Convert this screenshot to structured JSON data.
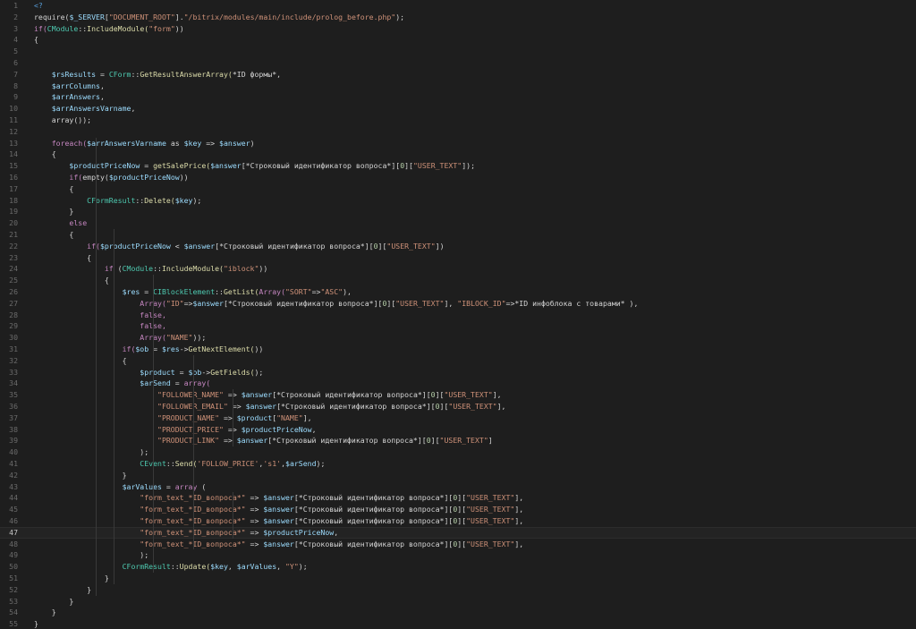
{
  "editor": {
    "lines": [
      [
        {
          "t": "<?",
          "c": "tag"
        }
      ],
      [
        {
          "t": "require(",
          "c": "op"
        },
        {
          "t": "$_SERVER",
          "c": "var"
        },
        {
          "t": "[",
          "c": "op"
        },
        {
          "t": "\"DOCUMENT_ROOT\"",
          "c": "str"
        },
        {
          "t": "].",
          "c": "op"
        },
        {
          "t": "\"/bitrix/modules/main/include/prolog_before.php\"",
          "c": "str"
        },
        {
          "t": ");",
          "c": "op"
        }
      ],
      [
        {
          "t": "if(",
          "c": "kw"
        },
        {
          "t": "CModule",
          "c": "cls"
        },
        {
          "t": "::",
          "c": "op"
        },
        {
          "t": "IncludeModule(",
          "c": "fn"
        },
        {
          "t": "\"form\"",
          "c": "str"
        },
        {
          "t": "))",
          "c": "op"
        }
      ],
      [
        {
          "t": "{",
          "c": "op"
        }
      ],
      [],
      [],
      [
        {
          "t": "    $rsResults",
          "c": "var"
        },
        {
          "t": " = ",
          "c": "op"
        },
        {
          "t": "CForm",
          "c": "cls"
        },
        {
          "t": "::",
          "c": "op"
        },
        {
          "t": "GetResultAnswerArray(",
          "c": "fn"
        },
        {
          "t": "*ID формы*,",
          "c": "op"
        }
      ],
      [
        {
          "t": "    $arrColumns",
          "c": "var"
        },
        {
          "t": ",",
          "c": "op"
        }
      ],
      [
        {
          "t": "    $arrAnswers",
          "c": "var"
        },
        {
          "t": ",",
          "c": "op"
        }
      ],
      [
        {
          "t": "    $arrAnswersVarname",
          "c": "var"
        },
        {
          "t": ",",
          "c": "op"
        }
      ],
      [
        {
          "t": "    array());",
          "c": "op"
        }
      ],
      [],
      [
        {
          "t": "    foreach(",
          "c": "kw"
        },
        {
          "t": "$arrAnswersVarname",
          "c": "var"
        },
        {
          "t": " as ",
          "c": "op"
        },
        {
          "t": "$key",
          "c": "var"
        },
        {
          "t": " => ",
          "c": "op"
        },
        {
          "t": "$answer",
          "c": "var"
        },
        {
          "t": ")",
          "c": "op"
        }
      ],
      [
        {
          "t": "    {",
          "c": "op"
        }
      ],
      [
        {
          "t": "        $productPriceNow",
          "c": "var"
        },
        {
          "t": " = ",
          "c": "op"
        },
        {
          "t": "getSalePrice(",
          "c": "fn"
        },
        {
          "t": "$answer",
          "c": "var"
        },
        {
          "t": "[*Строковый идентификатор вопроса*][",
          "c": "op"
        },
        {
          "t": "0",
          "c": "num"
        },
        {
          "t": "][",
          "c": "op"
        },
        {
          "t": "\"USER_TEXT\"",
          "c": "str"
        },
        {
          "t": "]);",
          "c": "op"
        }
      ],
      [
        {
          "t": "        if(",
          "c": "kw"
        },
        {
          "t": "empty(",
          "c": "op"
        },
        {
          "t": "$productPriceNow",
          "c": "var"
        },
        {
          "t": "))",
          "c": "op"
        }
      ],
      [
        {
          "t": "        {",
          "c": "op"
        }
      ],
      [
        {
          "t": "            CFormResult",
          "c": "cls"
        },
        {
          "t": "::",
          "c": "op"
        },
        {
          "t": "Delete(",
          "c": "fn"
        },
        {
          "t": "$key",
          "c": "var"
        },
        {
          "t": ");",
          "c": "op"
        }
      ],
      [
        {
          "t": "        }",
          "c": "op"
        }
      ],
      [
        {
          "t": "        else",
          "c": "kw"
        }
      ],
      [
        {
          "t": "        {",
          "c": "op"
        }
      ],
      [
        {
          "t": "            if(",
          "c": "kw"
        },
        {
          "t": "$productPriceNow",
          "c": "var"
        },
        {
          "t": " < ",
          "c": "op"
        },
        {
          "t": "$answer",
          "c": "var"
        },
        {
          "t": "[*Строковый идентификатор вопроса*][",
          "c": "op"
        },
        {
          "t": "0",
          "c": "num"
        },
        {
          "t": "][",
          "c": "op"
        },
        {
          "t": "\"USER_TEXT\"",
          "c": "str"
        },
        {
          "t": "])",
          "c": "op"
        }
      ],
      [
        {
          "t": "            {",
          "c": "op"
        }
      ],
      [
        {
          "t": "                if",
          "c": "kw"
        },
        {
          "t": " (",
          "c": "op"
        },
        {
          "t": "CModule",
          "c": "cls"
        },
        {
          "t": "::",
          "c": "op"
        },
        {
          "t": "IncludeModule(",
          "c": "fn"
        },
        {
          "t": "\"iblock\"",
          "c": "str"
        },
        {
          "t": "))",
          "c": "op"
        }
      ],
      [
        {
          "t": "                {",
          "c": "op"
        }
      ],
      [
        {
          "t": "                    $res",
          "c": "var"
        },
        {
          "t": " = ",
          "c": "op"
        },
        {
          "t": "CIBlockElement",
          "c": "cls"
        },
        {
          "t": "::",
          "c": "op"
        },
        {
          "t": "GetList(",
          "c": "fn"
        },
        {
          "t": "Array(",
          "c": "kw"
        },
        {
          "t": "\"SORT\"",
          "c": "str"
        },
        {
          "t": "=>",
          "c": "op"
        },
        {
          "t": "\"ASC\"",
          "c": "str"
        },
        {
          "t": "),",
          "c": "op"
        }
      ],
      [
        {
          "t": "                        Array(",
          "c": "kw"
        },
        {
          "t": "\"ID\"",
          "c": "str"
        },
        {
          "t": "=>",
          "c": "op"
        },
        {
          "t": "$answer",
          "c": "var"
        },
        {
          "t": "[*Строковый идентификатор вопроса*][",
          "c": "op"
        },
        {
          "t": "0",
          "c": "num"
        },
        {
          "t": "][",
          "c": "op"
        },
        {
          "t": "\"USER_TEXT\"",
          "c": "str"
        },
        {
          "t": "], ",
          "c": "op"
        },
        {
          "t": "\"IBLOCK_ID\"",
          "c": "str"
        },
        {
          "t": "=>*ID инфоблока с товарами* ),",
          "c": "op"
        }
      ],
      [
        {
          "t": "                        false,",
          "c": "kw"
        }
      ],
      [
        {
          "t": "                        false,",
          "c": "kw"
        }
      ],
      [
        {
          "t": "                        Array(",
          "c": "kw"
        },
        {
          "t": "\"NAME\"",
          "c": "str"
        },
        {
          "t": "));",
          "c": "op"
        }
      ],
      [
        {
          "t": "                    if(",
          "c": "kw"
        },
        {
          "t": "$ob",
          "c": "var"
        },
        {
          "t": " = ",
          "c": "op"
        },
        {
          "t": "$res",
          "c": "var"
        },
        {
          "t": "->",
          "c": "op"
        },
        {
          "t": "GetNextElement(",
          "c": "fn"
        },
        {
          "t": "))",
          "c": "op"
        }
      ],
      [
        {
          "t": "                    {",
          "c": "op"
        }
      ],
      [
        {
          "t": "                        $product",
          "c": "var"
        },
        {
          "t": " = ",
          "c": "op"
        },
        {
          "t": "$ob",
          "c": "var"
        },
        {
          "t": "->",
          "c": "op"
        },
        {
          "t": "GetFields(",
          "c": "fn"
        },
        {
          "t": ");",
          "c": "op"
        }
      ],
      [
        {
          "t": "                        $arSend",
          "c": "var"
        },
        {
          "t": " = ",
          "c": "op"
        },
        {
          "t": "array(",
          "c": "kw"
        }
      ],
      [
        {
          "t": "                            \"FOLLOWER_NAME\"",
          "c": "str"
        },
        {
          "t": " => ",
          "c": "op"
        },
        {
          "t": "$answer",
          "c": "var"
        },
        {
          "t": "[*Строковый идентификатор вопроса*][",
          "c": "op"
        },
        {
          "t": "0",
          "c": "num"
        },
        {
          "t": "][",
          "c": "op"
        },
        {
          "t": "\"USER_TEXT\"",
          "c": "str"
        },
        {
          "t": "],",
          "c": "op"
        }
      ],
      [
        {
          "t": "                            \"FOLLOWER_EMAIL\"",
          "c": "str"
        },
        {
          "t": " => ",
          "c": "op"
        },
        {
          "t": "$answer",
          "c": "var"
        },
        {
          "t": "[*Строковый идентификатор вопроса*][",
          "c": "op"
        },
        {
          "t": "0",
          "c": "num"
        },
        {
          "t": "][",
          "c": "op"
        },
        {
          "t": "\"USER_TEXT\"",
          "c": "str"
        },
        {
          "t": "],",
          "c": "op"
        }
      ],
      [
        {
          "t": "                            \"PRODUCT_NAME\"",
          "c": "str"
        },
        {
          "t": " => ",
          "c": "op"
        },
        {
          "t": "$product",
          "c": "var"
        },
        {
          "t": "[",
          "c": "op"
        },
        {
          "t": "\"NAME\"",
          "c": "str"
        },
        {
          "t": "],",
          "c": "op"
        }
      ],
      [
        {
          "t": "                            \"PRODUCT_PRICE\"",
          "c": "str"
        },
        {
          "t": " => ",
          "c": "op"
        },
        {
          "t": "$productPriceNow",
          "c": "var"
        },
        {
          "t": ",",
          "c": "op"
        }
      ],
      [
        {
          "t": "                            \"PRODUCT_LINK\"",
          "c": "str"
        },
        {
          "t": " => ",
          "c": "op"
        },
        {
          "t": "$answer",
          "c": "var"
        },
        {
          "t": "[*Строковый идентификатор вопроса*][",
          "c": "op"
        },
        {
          "t": "0",
          "c": "num"
        },
        {
          "t": "][",
          "c": "op"
        },
        {
          "t": "\"USER_TEXT\"",
          "c": "str"
        },
        {
          "t": "]",
          "c": "op"
        }
      ],
      [
        {
          "t": "                        );",
          "c": "op"
        }
      ],
      [
        {
          "t": "                        CEvent",
          "c": "cls"
        },
        {
          "t": "::",
          "c": "op"
        },
        {
          "t": "Send(",
          "c": "fn"
        },
        {
          "t": "'FOLLOW_PRICE'",
          "c": "str"
        },
        {
          "t": ",",
          "c": "op"
        },
        {
          "t": "'s1'",
          "c": "str"
        },
        {
          "t": ",",
          "c": "op"
        },
        {
          "t": "$arSend",
          "c": "var"
        },
        {
          "t": ");",
          "c": "op"
        }
      ],
      [
        {
          "t": "                    }",
          "c": "op"
        }
      ],
      [
        {
          "t": "                    $arValues",
          "c": "var"
        },
        {
          "t": " = ",
          "c": "op"
        },
        {
          "t": "array",
          "c": "kw"
        },
        {
          "t": " (",
          "c": "op"
        }
      ],
      [
        {
          "t": "                        \"form_text_*ID_вопроса*\"",
          "c": "str"
        },
        {
          "t": " => ",
          "c": "op"
        },
        {
          "t": "$answer",
          "c": "var"
        },
        {
          "t": "[*Строковый идентификатор вопроса*][",
          "c": "op"
        },
        {
          "t": "0",
          "c": "num"
        },
        {
          "t": "][",
          "c": "op"
        },
        {
          "t": "\"USER_TEXT\"",
          "c": "str"
        },
        {
          "t": "],",
          "c": "op"
        }
      ],
      [
        {
          "t": "                        \"form_text_*ID_вопроса*\"",
          "c": "str"
        },
        {
          "t": " => ",
          "c": "op"
        },
        {
          "t": "$answer",
          "c": "var"
        },
        {
          "t": "[*Строковый идентификатор вопроса*][",
          "c": "op"
        },
        {
          "t": "0",
          "c": "num"
        },
        {
          "t": "][",
          "c": "op"
        },
        {
          "t": "\"USER_TEXT\"",
          "c": "str"
        },
        {
          "t": "],",
          "c": "op"
        }
      ],
      [
        {
          "t": "                        \"form_text_*ID_вопроса*\"",
          "c": "str"
        },
        {
          "t": " => ",
          "c": "op"
        },
        {
          "t": "$answer",
          "c": "var"
        },
        {
          "t": "[*Строковый идентификатор вопроса*][",
          "c": "op"
        },
        {
          "t": "0",
          "c": "num"
        },
        {
          "t": "][",
          "c": "op"
        },
        {
          "t": "\"USER_TEXT\"",
          "c": "str"
        },
        {
          "t": "],",
          "c": "op"
        }
      ],
      [
        {
          "t": "                        \"form_text_*ID_вопроса*\"",
          "c": "str"
        },
        {
          "t": " => ",
          "c": "op"
        },
        {
          "t": "$productPriceNow",
          "c": "var"
        },
        {
          "t": ",",
          "c": "op"
        }
      ],
      [
        {
          "t": "                        \"form_text_*ID_вопроса*\"",
          "c": "str"
        },
        {
          "t": " => ",
          "c": "op"
        },
        {
          "t": "$answer",
          "c": "var"
        },
        {
          "t": "[*Строковый идентификатор вопроса*][",
          "c": "op"
        },
        {
          "t": "0",
          "c": "num"
        },
        {
          "t": "][",
          "c": "op"
        },
        {
          "t": "\"USER_TEXT\"",
          "c": "str"
        },
        {
          "t": "],",
          "c": "op"
        }
      ],
      [
        {
          "t": "                        );",
          "c": "op"
        }
      ],
      [
        {
          "t": "                    CFormResult",
          "c": "cls"
        },
        {
          "t": "::",
          "c": "op"
        },
        {
          "t": "Update(",
          "c": "fn"
        },
        {
          "t": "$key",
          "c": "var"
        },
        {
          "t": ", ",
          "c": "op"
        },
        {
          "t": "$arValues",
          "c": "var"
        },
        {
          "t": ", ",
          "c": "op"
        },
        {
          "t": "\"Y\"",
          "c": "str"
        },
        {
          "t": ");",
          "c": "op"
        }
      ],
      [
        {
          "t": "                }",
          "c": "op"
        }
      ],
      [
        {
          "t": "            }",
          "c": "op"
        }
      ],
      [
        {
          "t": "        }",
          "c": "op"
        }
      ],
      [
        {
          "t": "    }",
          "c": "op"
        }
      ],
      [
        {
          "t": "}",
          "c": "op"
        }
      ],
      []
    ],
    "current_line": 47,
    "colors": {
      "background": "#1e1e1e",
      "keyword": "#c586c0",
      "tag": "#569cd6",
      "variable": "#9cdcfe",
      "string": "#ce9178",
      "class": "#4ec9b0",
      "function": "#dcdcaa",
      "number": "#b5cea8",
      "plain": "#d4d4d4",
      "line_number": "#6b6b6b"
    }
  }
}
